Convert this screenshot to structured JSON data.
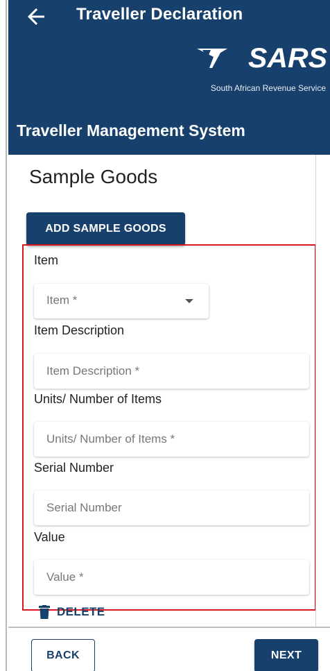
{
  "app_bar": {
    "back_icon": "arrow-left-icon",
    "title": "Traveller Declaration",
    "logo_text": "SARS",
    "logo_tagline": "South African Revenue Service",
    "system_title": "Traveller Management System"
  },
  "page": {
    "heading": "Sample Goods",
    "add_button_label": "ADD SAMPLE GOODS"
  },
  "form": {
    "item": {
      "label": "Item",
      "placeholder": "Item *",
      "value": ""
    },
    "description": {
      "label": "Item Description",
      "placeholder": "Item Description *",
      "value": ""
    },
    "units": {
      "label": "Units/ Number of Items",
      "placeholder": "Units/ Number of Items *",
      "value": ""
    },
    "serial": {
      "label": "Serial Number",
      "placeholder": "Serial Number",
      "value": ""
    },
    "value": {
      "label": "Value",
      "placeholder": "Value *",
      "value": ""
    }
  },
  "delete": {
    "icon": "trash-icon",
    "label": "DELETE"
  },
  "footer": {
    "back_label": "BACK",
    "next_label": "NEXT"
  },
  "colors": {
    "primary": "#17406c",
    "highlight_border": "#d9161e"
  }
}
